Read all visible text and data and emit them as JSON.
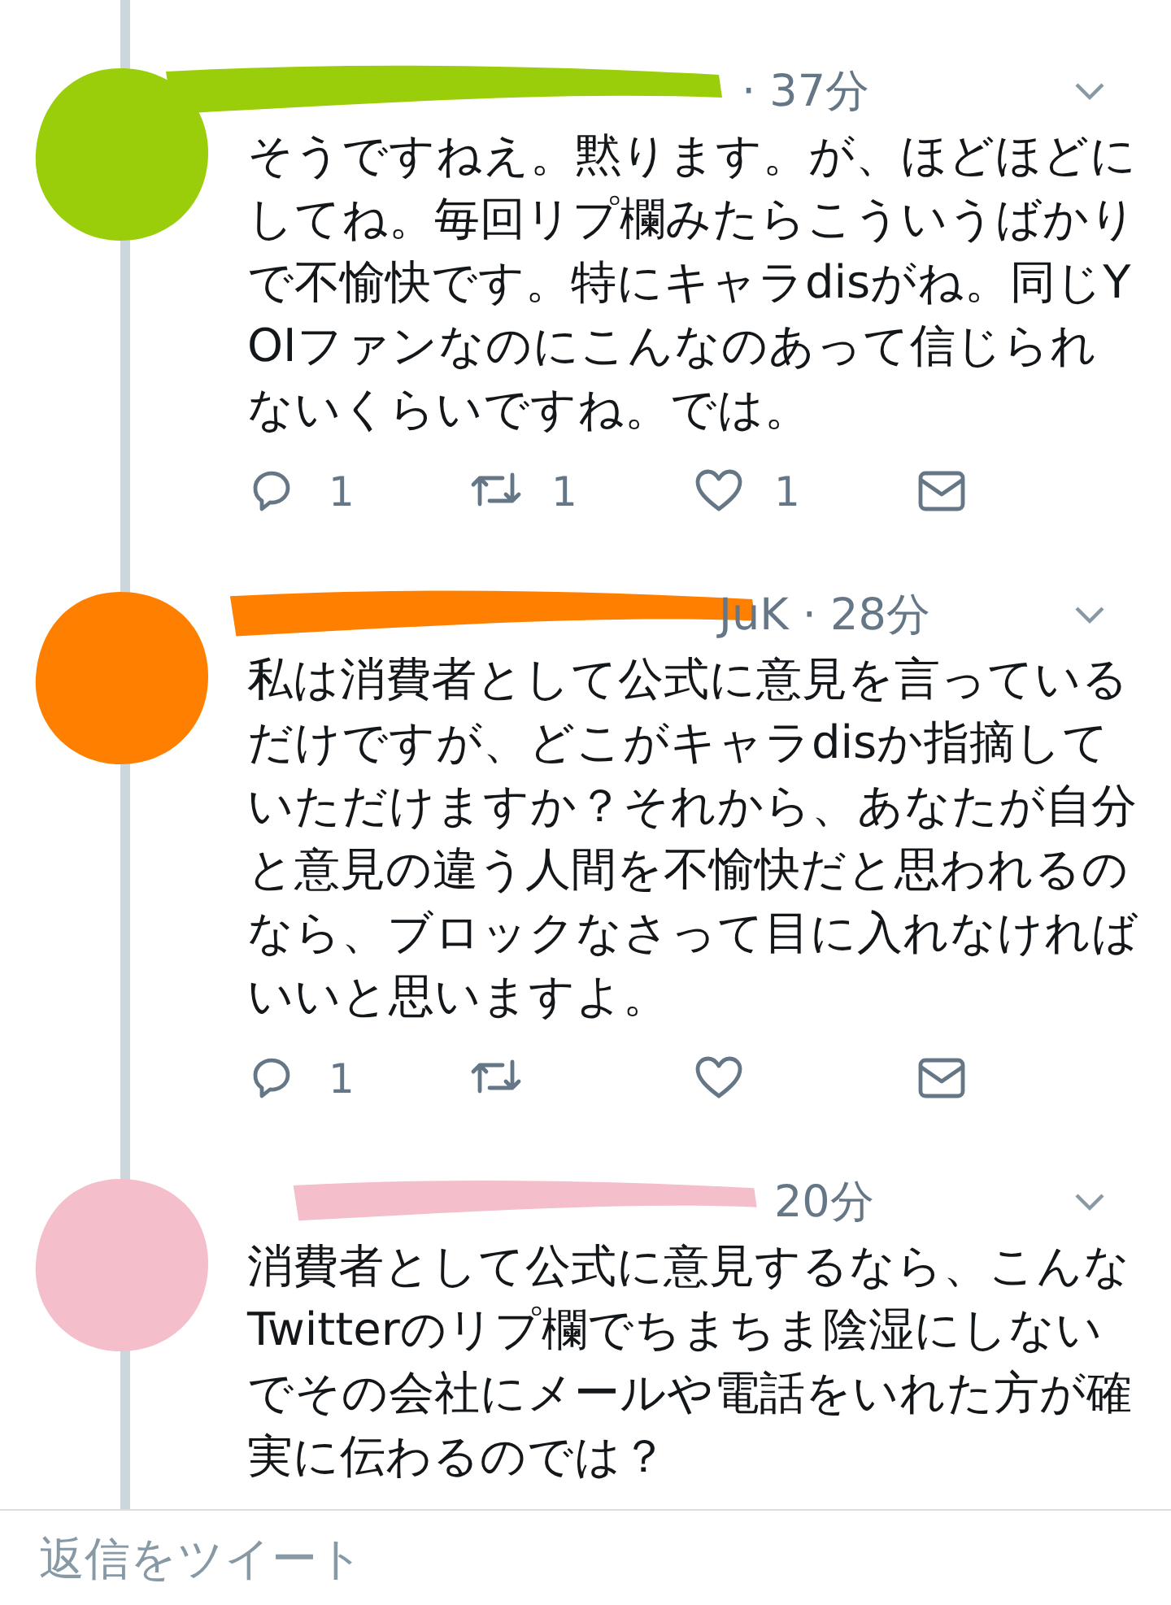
{
  "tweets": [
    {
      "header": "· 37分",
      "text": "そうですねえ。黙ります。が、ほどほどにしてね。毎回リプ欄みたらこういうばかりで不愉快です。特にキャラdisがね。同じYOIファンなのにこんなのあって信じられないくらいですね。では。",
      "reply_count": "1",
      "retweet_count": "1",
      "like_count": "1"
    },
    {
      "header": "JuK · 28分",
      "text": "私は消費者として公式に意見を言っているだけですが、どこがキャラdisか指摘していただけますか？それから、あなたが自分と意見の違う人間を不愉快だと思われるのなら、ブロックなさって目に入れなければいいと思いますよ。",
      "reply_count": "1"
    },
    {
      "header": "20分",
      "text": "消費者として公式に意見するなら、こんなTwitterのリプ欄でちまちま陰湿にしないでその会社にメールや電話をいれた方が確実に伝わるのでは？"
    }
  ],
  "reply_bar": {
    "placeholder": "返信をツイート"
  }
}
